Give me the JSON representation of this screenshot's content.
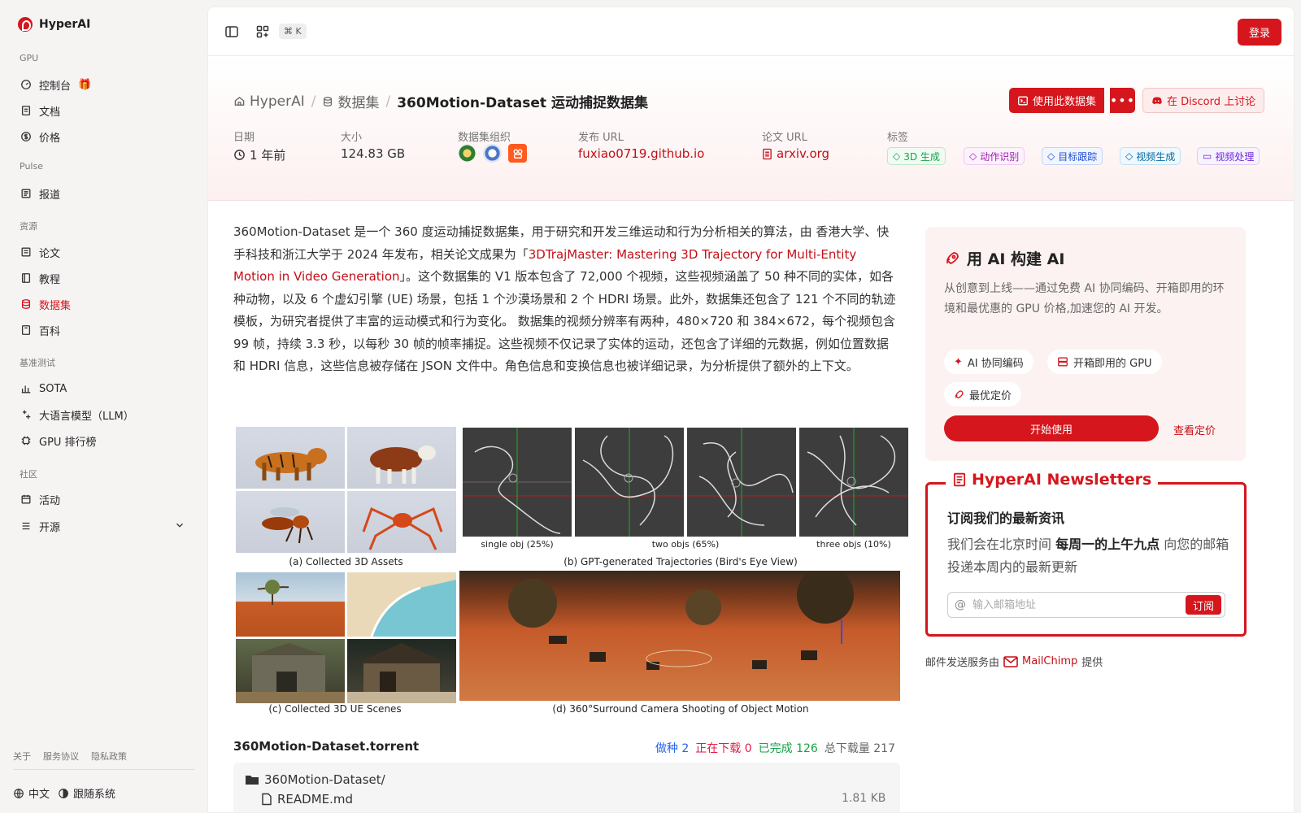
{
  "app": {
    "name": "HyperAI"
  },
  "sidebar": {
    "sections": [
      {
        "title": "GPU"
      },
      {
        "title": "Pulse"
      },
      {
        "title": "资源"
      },
      {
        "title": "基准测试"
      },
      {
        "title": "社区"
      }
    ],
    "items": [
      {
        "label": "控制台"
      },
      {
        "label": "文档"
      },
      {
        "label": "价格"
      },
      {
        "label": "报道"
      },
      {
        "label": "论文"
      },
      {
        "label": "教程"
      },
      {
        "label": "数据集"
      },
      {
        "label": "百科"
      },
      {
        "label": "SOTA"
      },
      {
        "label": "大语言模型（LLM）"
      },
      {
        "label": "GPU 排行榜"
      },
      {
        "label": "活动"
      },
      {
        "label": "开源"
      }
    ],
    "footer_links": [
      "关于",
      "服务协议",
      "隐私政策"
    ],
    "language": "中文",
    "theme": "跟随系统"
  },
  "topbar": {
    "shortcut": "⌘ K",
    "login": "登录"
  },
  "breadcrumb": {
    "home": "HyperAI",
    "section": "数据集",
    "current": "360Motion-Dataset 运动捕捉数据集"
  },
  "actions": {
    "use_dataset": "使用此数据集",
    "more": "•••",
    "discord": "在 Discord 上讨论"
  },
  "meta": {
    "date_label": "日期",
    "date_value": "1 年前",
    "size_label": "大小",
    "size_value": "124.83 GB",
    "org_label": "数据集组织",
    "publish_label": "发布 URL",
    "publish_value": "fuxiao0719.github.io",
    "paper_label": "论文 URL",
    "paper_value": "arxiv.org",
    "tags_label": "标签"
  },
  "tags": [
    {
      "label": "3D 生成",
      "color": "#16a34a"
    },
    {
      "label": "动作识别",
      "color": "#c026d3"
    },
    {
      "label": "目标跟踪",
      "color": "#2563eb"
    },
    {
      "label": "视频生成",
      "color": "#0284c7"
    },
    {
      "label": "视频处理",
      "color": "#7c3aed"
    }
  ],
  "description": {
    "p1": "360Motion-Dataset 是一个 360 度运动捕捉数据集，用于研究和开发三维运动和行为分析相关的算法，由 香港大学、快手科技和浙江大学于 2024 年发布，相关论文成果为「",
    "link": "3DTrajMaster: Mastering 3D Trajectory for Multi-Entity Motion in Video Generation",
    "p2": "」。这个数据集的 V1 版本包含了 72,000 个视频，这些视频涵盖了 50 种不同的实体，如各种动物，以及 6 个虚幻引擎 (UE) 场景，包括 1 个沙漠场景和 2 个 HDRI 场景。此外，数据集还包含了 121 个不同的轨迹模板，为研究者提供了丰富的运动模式和行为变化。 数据集的视频分辨率有两种，480×720 和 384×672，每个视频包含 99 帧，持续 3.3 秒，以每秒 30 帧的帧率捕捉。这些视频不仅记录了实体的运动，还包含了详细的元数据，例如位置数据和 HDRI 信息，这些信息被存储在 JSON 文件中。角色信息和变换信息也被详细记录，为分析提供了额外的上下文。"
  },
  "figure": {
    "cap_a": "(a) Collected 3D Assets",
    "cap_b": "(b) GPT-generated Trajectories (Bird's Eye View)",
    "cap_c": "(c) Collected 3D UE Scenes",
    "cap_d": "(d) 360°Surround Camera Shooting of Object Motion",
    "sub1": "single obj (25%)",
    "sub2": "two objs (65%)",
    "sub3": "three objs (10%)"
  },
  "torrent": {
    "title": "360Motion-Dataset.torrent",
    "seeds": "做种 2",
    "downloading": "正在下载 0",
    "completed": "已完成 126",
    "total": "总下载量 217",
    "folder": "360Motion-Dataset/",
    "file": "README.md",
    "file_size": "1.81 KB"
  },
  "ai_card": {
    "title": "用 AI 构建 AI",
    "desc": "从创意到上线——通过免费 AI 协同编码、开箱即用的环境和最优惠的 GPU 价格,加速您的 AI 开发。",
    "chip1": "AI 协同编码",
    "chip2": "开箱即用的 GPU",
    "chip3": "最优定价",
    "start": "开始使用",
    "pricing": "查看定价"
  },
  "newsletter": {
    "title": "HyperAI Newsletters",
    "subtitle": "订阅我们的最新资讯",
    "text_pre": "我们会在北京时间 ",
    "text_bold": "每周一的上午九点",
    "text_post": " 向您的邮箱投递本周内的最新更新",
    "placeholder": "输入邮箱地址",
    "subscribe": "订阅",
    "footer_pre": "邮件发送服务由",
    "footer_brand": "MailChimp",
    "footer_post": "提供"
  },
  "colors": {
    "accent": "#d5161d",
    "seed": "#2563eb",
    "downloading": "#e11d48",
    "completed": "#16a34a"
  }
}
